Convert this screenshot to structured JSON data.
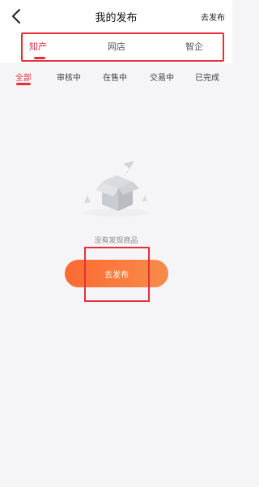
{
  "header": {
    "title": "我的发布",
    "publish_link": "去发布"
  },
  "tabs": [
    {
      "label": "知产",
      "active": true
    },
    {
      "label": "网店",
      "active": false
    },
    {
      "label": "智企",
      "active": false
    }
  ],
  "subtabs": [
    {
      "label": "全部",
      "active": true
    },
    {
      "label": "审核中",
      "active": false
    },
    {
      "label": "在售中",
      "active": false
    },
    {
      "label": "交易中",
      "active": false
    },
    {
      "label": "已完成",
      "active": false
    }
  ],
  "empty_state": {
    "message": "没有发现商品",
    "button_label": "去发布",
    "icon": "empty-box-icon"
  },
  "colors": {
    "accent": "#e5303c",
    "button_gradient_start": "#fd6a33",
    "button_gradient_end": "#f78c4a"
  }
}
